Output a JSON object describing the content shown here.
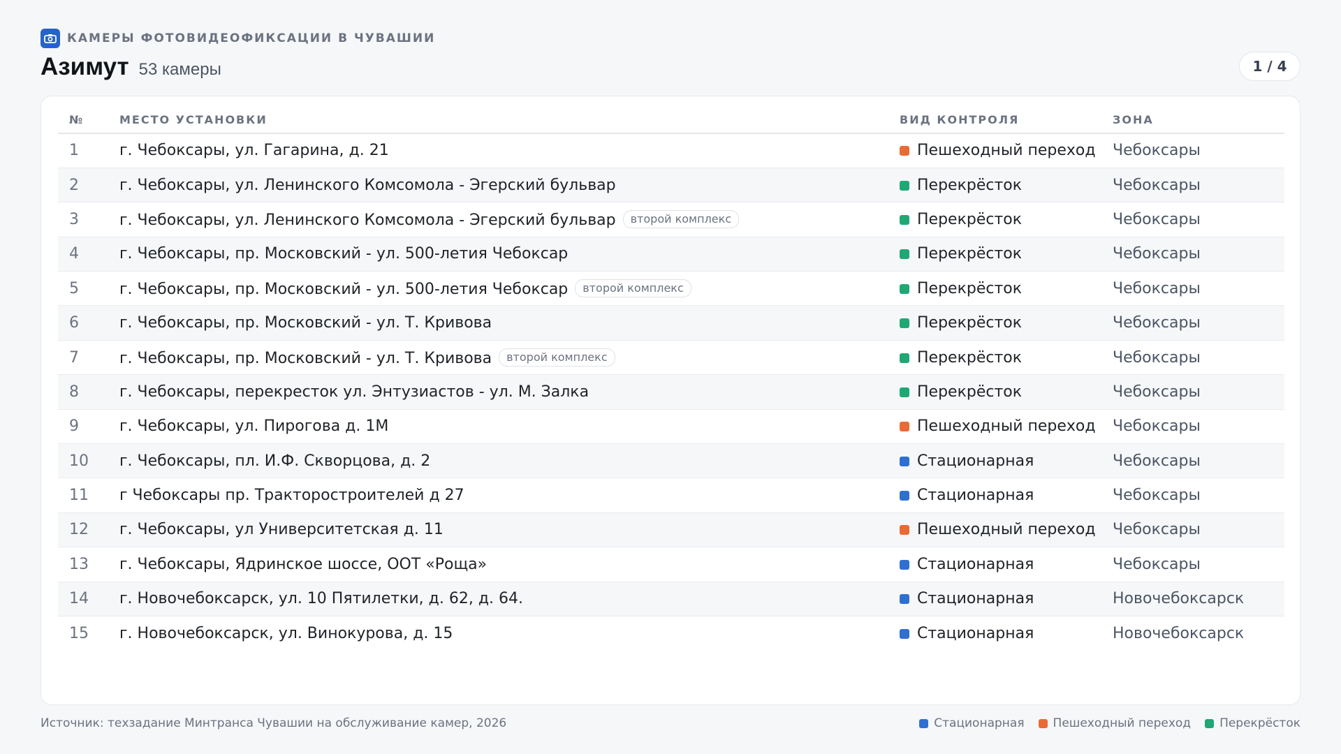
{
  "header": {
    "kicker": "КАМЕРЫ ФОТОВИДЕОФИКСАЦИИ В ЧУВАШИИ",
    "title": "Азимут",
    "count": "53 камеры",
    "pager": "1 / 4"
  },
  "table": {
    "columns": {
      "num": "№",
      "place": "МЕСТО УСТАНОВКИ",
      "type": "ВИД КОНТРОЛЯ",
      "zone": "ЗОНА"
    },
    "rows": [
      {
        "num": "1",
        "place": "г. Чебоксары, ул. Гагарина, д. 21",
        "badge": "",
        "type": "Пешеходный переход",
        "kind": "ped",
        "zone": "Чебоксары"
      },
      {
        "num": "2",
        "place": "г. Чебоксары, ул. Ленинского Комсомола - Эгерский бульвар",
        "badge": "",
        "type": "Перекрёсток",
        "kind": "cross",
        "zone": "Чебоксары"
      },
      {
        "num": "3",
        "place": "г. Чебоксары, ул. Ленинского Комсомола - Эгерский бульвар",
        "badge": "второй комплекс",
        "type": "Перекрёсток",
        "kind": "cross",
        "zone": "Чебоксары"
      },
      {
        "num": "4",
        "place": "г. Чебоксары, пр. Московский - ул. 500-летия Чебоксар",
        "badge": "",
        "type": "Перекрёсток",
        "kind": "cross",
        "zone": "Чебоксары"
      },
      {
        "num": "5",
        "place": "г. Чебоксары, пр. Московский - ул. 500-летия Чебоксар",
        "badge": "второй комплекс",
        "type": "Перекрёсток",
        "kind": "cross",
        "zone": "Чебоксары"
      },
      {
        "num": "6",
        "place": "г. Чебоксары, пр. Московский - ул. Т. Кривова",
        "badge": "",
        "type": "Перекрёсток",
        "kind": "cross",
        "zone": "Чебоксары"
      },
      {
        "num": "7",
        "place": "г. Чебоксары, пр. Московский - ул. Т. Кривова",
        "badge": "второй комплекс",
        "type": "Перекрёсток",
        "kind": "cross",
        "zone": "Чебоксары"
      },
      {
        "num": "8",
        "place": "г. Чебоксары, перекресток ул. Энтузиастов - ул. М. Залка",
        "badge": "",
        "type": "Перекрёсток",
        "kind": "cross",
        "zone": "Чебоксары"
      },
      {
        "num": "9",
        "place": "г. Чебоксары, ул. Пирогова д. 1М",
        "badge": "",
        "type": "Пешеходный переход",
        "kind": "ped",
        "zone": "Чебоксары"
      },
      {
        "num": "10",
        "place": "г. Чебоксары, пл. И.Ф. Скворцова, д. 2",
        "badge": "",
        "type": "Стационарная",
        "kind": "stat",
        "zone": "Чебоксары"
      },
      {
        "num": "11",
        "place": "г Чебоксары пр. Тракторостроителей д 27",
        "badge": "",
        "type": "Стационарная",
        "kind": "stat",
        "zone": "Чебоксары"
      },
      {
        "num": "12",
        "place": "г. Чебоксары, ул Университетская д. 11",
        "badge": "",
        "type": "Пешеходный переход",
        "kind": "ped",
        "zone": "Чебоксары"
      },
      {
        "num": "13",
        "place": "г. Чебоксары, Ядринское шоссе, ООТ «Роща»",
        "badge": "",
        "type": "Стационарная",
        "kind": "stat",
        "zone": "Чебоксары"
      },
      {
        "num": "14",
        "place": "г. Новочебоксарск, ул. 10 Пятилетки, д. 62, д. 64.",
        "badge": "",
        "type": "Стационарная",
        "kind": "stat",
        "zone": "Новочебоксарск"
      },
      {
        "num": "15",
        "place": "г. Новочебоксарск, ул. Винокурова, д. 15",
        "badge": "",
        "type": "Стационарная",
        "kind": "stat",
        "zone": "Новочебоксарск"
      }
    ]
  },
  "footer": {
    "source": "Источник: техзадание Минтранса Чувашии на обслуживание камер, 2026",
    "legend": [
      {
        "label": "Стационарная",
        "kind": "stat"
      },
      {
        "label": "Пешеходный переход",
        "kind": "ped"
      },
      {
        "label": "Перекрёсток",
        "kind": "cross"
      }
    ]
  },
  "colors": {
    "stat": "#2f6fd0",
    "ped": "#ea6a35",
    "cross": "#1fa874",
    "brand_icon": "#2563c9"
  },
  "icons": {
    "kicker": "camera-icon"
  }
}
